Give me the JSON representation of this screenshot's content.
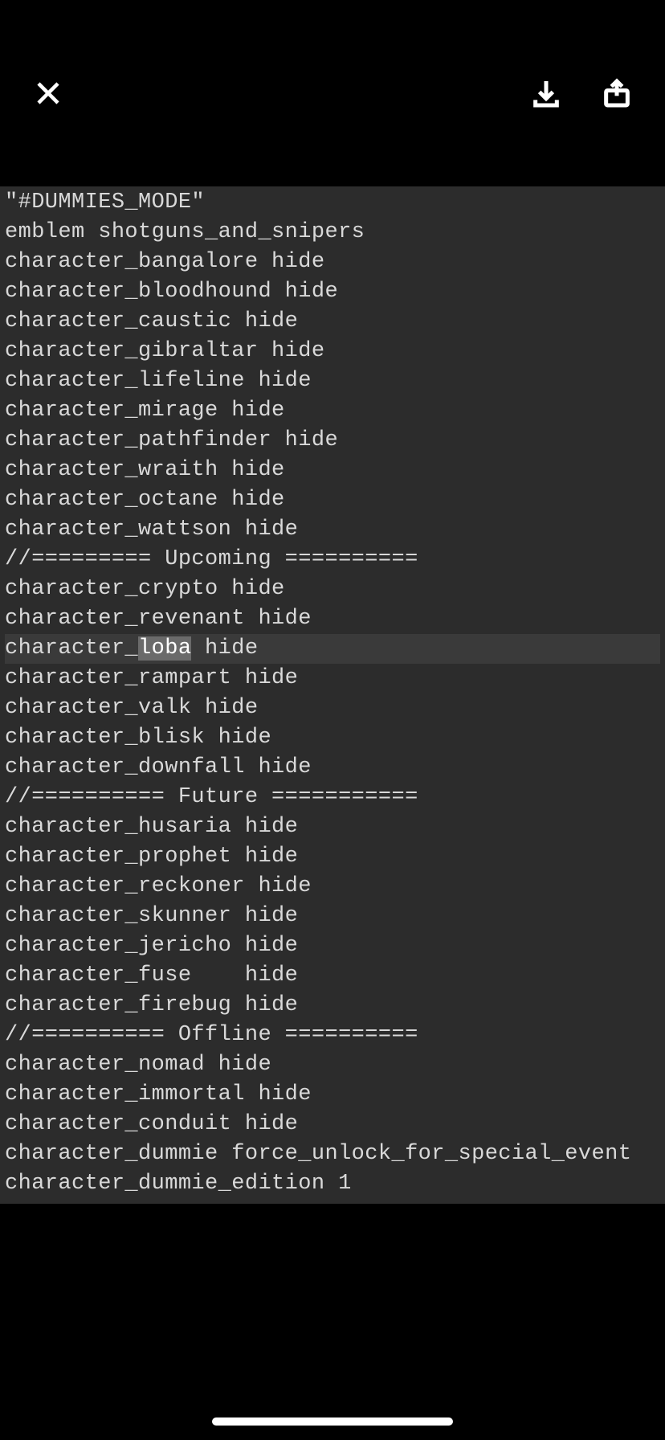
{
  "lines": [
    {
      "text": "\"#DUMMIES_MODE\"",
      "highlight": false
    },
    {
      "text": "emblem shotguns_and_snipers",
      "highlight": false
    },
    {
      "text": "character_bangalore hide",
      "highlight": false
    },
    {
      "text": "character_bloodhound hide",
      "highlight": false
    },
    {
      "text": "character_caustic hide",
      "highlight": false
    },
    {
      "text": "character_gibraltar hide",
      "highlight": false
    },
    {
      "text": "character_lifeline hide",
      "highlight": false
    },
    {
      "text": "character_mirage hide",
      "highlight": false
    },
    {
      "text": "character_pathfinder hide",
      "highlight": false
    },
    {
      "text": "character_wraith hide",
      "highlight": false
    },
    {
      "text": "character_octane hide",
      "highlight": false
    },
    {
      "text": "character_wattson hide",
      "highlight": false
    },
    {
      "text": "//========= Upcoming ==========",
      "highlight": false
    },
    {
      "text": "character_crypto hide",
      "highlight": false
    },
    {
      "text": "character_revenant hide",
      "highlight": false
    },
    {
      "pre": "character_",
      "sel": "loba",
      "post": " hide",
      "highlight": true
    },
    {
      "text": "character_rampart hide",
      "highlight": false
    },
    {
      "text": "character_valk hide",
      "highlight": false
    },
    {
      "text": "character_blisk hide",
      "highlight": false
    },
    {
      "text": "character_downfall hide",
      "highlight": false
    },
    {
      "text": "//========== Future ===========",
      "highlight": false
    },
    {
      "text": "character_husaria hide",
      "highlight": false
    },
    {
      "text": "character_prophet hide",
      "highlight": false
    },
    {
      "text": "character_reckoner hide",
      "highlight": false
    },
    {
      "text": "character_skunner hide",
      "highlight": false
    },
    {
      "text": "character_jericho hide",
      "highlight": false
    },
    {
      "text": "character_fuse    hide",
      "highlight": false
    },
    {
      "text": "character_firebug hide",
      "highlight": false
    },
    {
      "text": "//========== Offline ==========",
      "highlight": false
    },
    {
      "text": "character_nomad hide",
      "highlight": false
    },
    {
      "text": "character_immortal hide",
      "highlight": false
    },
    {
      "text": "character_conduit hide",
      "highlight": false
    },
    {
      "text": "character_dummie force_unlock_for_special_event",
      "highlight": false
    },
    {
      "text": "character_dummie_edition 1",
      "highlight": false
    }
  ]
}
